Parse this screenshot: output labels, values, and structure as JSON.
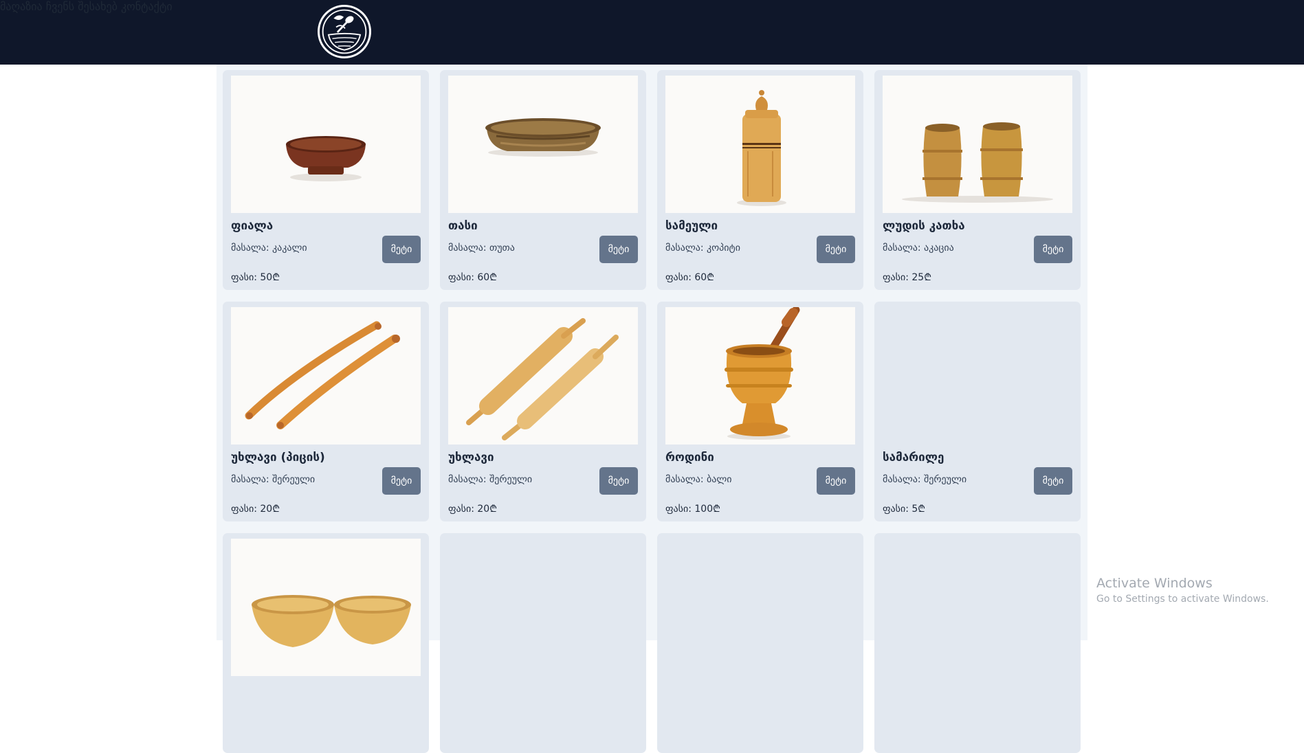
{
  "header": {
    "logo_icon": "woodturning-logo-icon",
    "nav": [
      {
        "label": "მაღაზია"
      },
      {
        "label": "ჩვენს შესახებ"
      },
      {
        "label": "კონტაქტი"
      }
    ]
  },
  "colors": {
    "header_bg": "#0f172a",
    "card_bg": "#e2e8f0",
    "button_bg": "#64748b"
  },
  "products": [
    {
      "name": "ფიალა",
      "material": "მასალა: კაკალი",
      "price": "ფასი: 50₾",
      "button": "მეტი",
      "image": "dark-walnut-bowl"
    },
    {
      "name": "თასი",
      "material": "მასალა: თუთა",
      "price": "ფასი: 60₾",
      "button": "მეტი",
      "image": "wide-mulberry-bowl"
    },
    {
      "name": "სამეული",
      "material": "მასალა: კოპიტი",
      "price": "ფასი: 60₾",
      "button": "მეტი",
      "image": "lidded-jar"
    },
    {
      "name": "ლუდის კათხა",
      "material": "მასალა: აკაცია",
      "price": "ფასი: 25₾",
      "button": "მეტი",
      "image": "beer-mugs"
    },
    {
      "name": "უხლავი (პიცის)",
      "material": "მასალა: შერეული",
      "price": "ფასი: 20₾",
      "button": "მეტი",
      "image": "pizza-rolling-pins"
    },
    {
      "name": "უხლავი",
      "material": "მასალა: შერეული",
      "price": "ფასი: 20₾",
      "button": "მეტი",
      "image": "rolling-pins-with-handles"
    },
    {
      "name": "როდინი",
      "material": "მასალა: ბალი",
      "price": "ფასი: 100₾",
      "button": "მეტი",
      "image": "mortar-and-pestle"
    },
    {
      "name": "სამარილე",
      "material": "მასალა: შერეული",
      "price": "ფასი: 5₾",
      "button": "მეტი",
      "image": ""
    }
  ],
  "partial_products": [
    {
      "image": "two-bowls"
    },
    {
      "image": ""
    },
    {
      "image": ""
    },
    {
      "image": ""
    }
  ],
  "watermark": {
    "title": "Activate Windows",
    "subtitle": "Go to Settings to activate Windows."
  }
}
